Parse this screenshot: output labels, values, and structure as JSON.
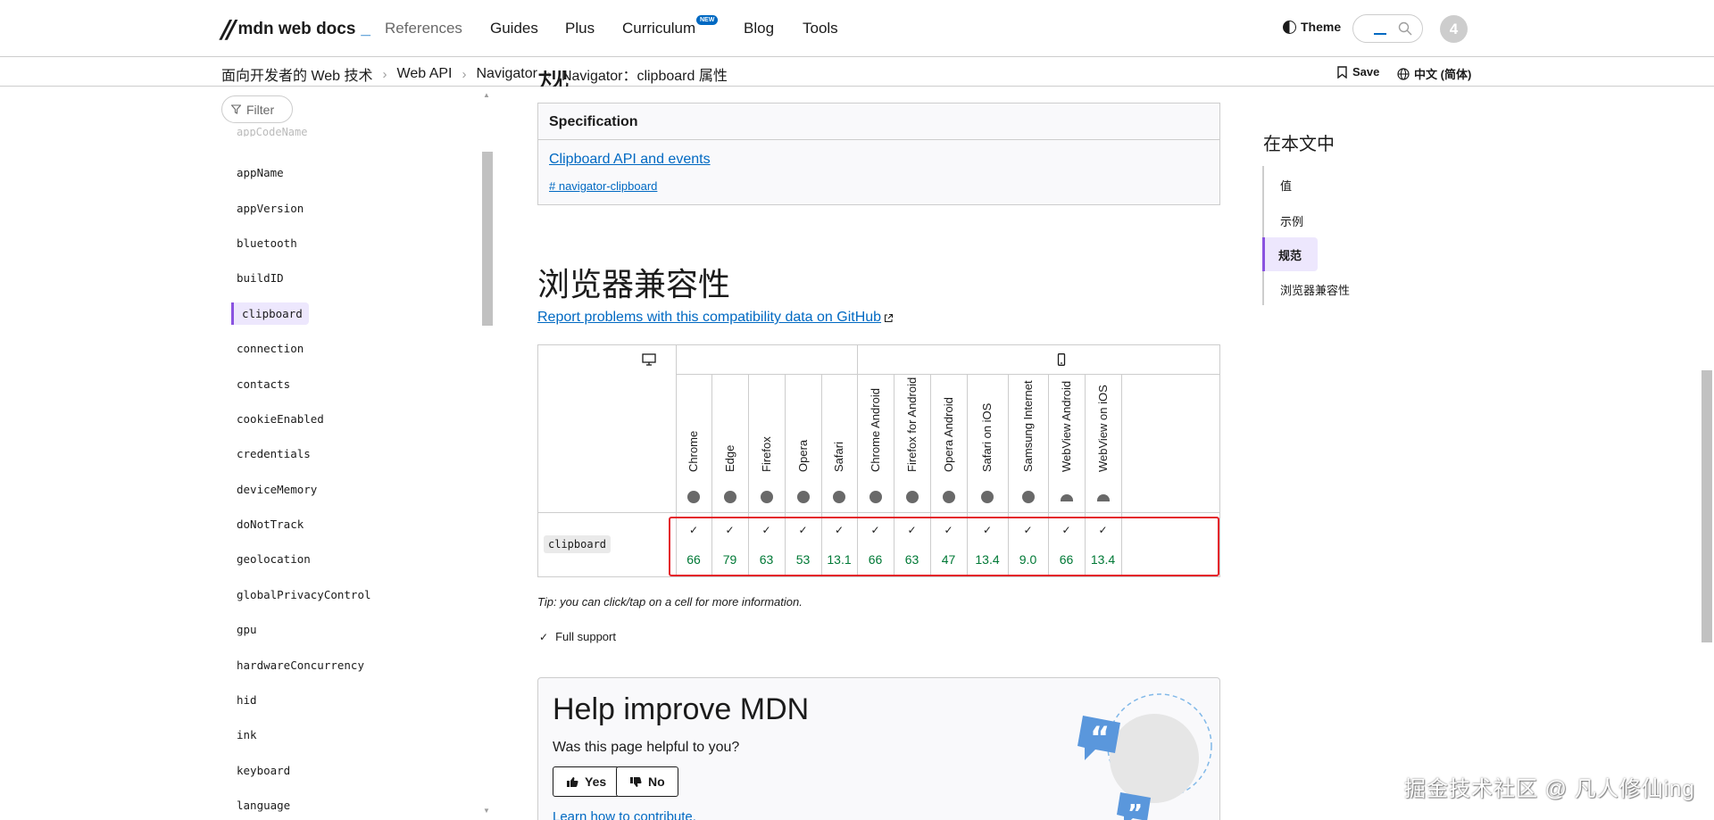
{
  "header": {
    "logo_text": "mdn web docs",
    "logo_suffix": "_",
    "nav": [
      "References",
      "Guides",
      "Plus",
      "Curriculum",
      "Blog",
      "Tools"
    ],
    "new_badge": "NEW",
    "theme_label": "Theme",
    "avatar_initial": "4"
  },
  "breadcrumb": {
    "items": [
      "面向开发者的 Web 技术",
      "Web API",
      "Navigator",
      "Navigator：clipboard 属性"
    ],
    "save_label": "Save",
    "language_label": "中文 (简体)"
  },
  "sidebar": {
    "filter_placeholder": "Filter",
    "faded_item": "appCodeName",
    "items": [
      {
        "label": "appName"
      },
      {
        "label": "appVersion"
      },
      {
        "label": "bluetooth"
      },
      {
        "label": "buildID"
      },
      {
        "label": "clipboard",
        "active": true
      },
      {
        "label": "connection"
      },
      {
        "label": "contacts"
      },
      {
        "label": "cookieEnabled"
      },
      {
        "label": "credentials"
      },
      {
        "label": "deviceMemory"
      },
      {
        "label": "doNotTrack"
      },
      {
        "label": "geolocation"
      },
      {
        "label": "globalPrivacyControl"
      },
      {
        "label": "gpu"
      },
      {
        "label": "hardwareConcurrency"
      },
      {
        "label": "hid"
      },
      {
        "label": "ink"
      },
      {
        "label": "keyboard"
      },
      {
        "label": "language"
      }
    ]
  },
  "main": {
    "partial_heading": "规范",
    "spec": {
      "header": "Specification",
      "link": "Clipboard API and events",
      "anchor": "# navigator-clipboard"
    },
    "compat_title": "浏览器兼容性",
    "report_link": "Report problems with this compatibility data on GitHub",
    "compat": {
      "feature": "clipboard",
      "browsers": [
        {
          "name": "Chrome",
          "version": "66",
          "icon": "chrome-icon"
        },
        {
          "name": "Edge",
          "version": "79",
          "icon": "edge-icon"
        },
        {
          "name": "Firefox",
          "version": "63",
          "icon": "firefox-icon"
        },
        {
          "name": "Opera",
          "version": "53",
          "icon": "opera-icon"
        },
        {
          "name": "Safari",
          "version": "13.1",
          "icon": "safari-icon"
        },
        {
          "name": "Chrome Android",
          "version": "66",
          "icon": "chrome-icon"
        },
        {
          "name": "Firefox for Android",
          "version": "63",
          "icon": "firefox-icon"
        },
        {
          "name": "Opera Android",
          "version": "47",
          "icon": "opera-icon"
        },
        {
          "name": "Safari on iOS",
          "version": "13.4",
          "icon": "safari-icon"
        },
        {
          "name": "Samsung Internet",
          "version": "9.0",
          "icon": "samsung-internet-icon"
        },
        {
          "name": "WebView Android",
          "version": "66",
          "icon": "android-icon"
        },
        {
          "name": "WebView on iOS",
          "version": "13.4",
          "icon": "android-icon"
        }
      ],
      "support_color": "#007936",
      "highlight_color": "#e4202a"
    },
    "tip": "Tip: you can click/tap on a cell for more information.",
    "legend": "Full support",
    "help": {
      "title": "Help improve MDN",
      "question": "Was this page helpful to you?",
      "yes": "Yes",
      "no": "No",
      "learn": "Learn how to contribute."
    }
  },
  "toc": {
    "title": "在本文中",
    "items": [
      {
        "label": "值"
      },
      {
        "label": "示例"
      },
      {
        "label": "规范",
        "active": true
      },
      {
        "label": "浏览器兼容性"
      }
    ]
  },
  "watermark": "掘金技术社区 @ 凡人修仙ing",
  "colors": {
    "link": "#0069c2",
    "accent": "#8a53e0",
    "active_bg": "#ede7fd"
  }
}
